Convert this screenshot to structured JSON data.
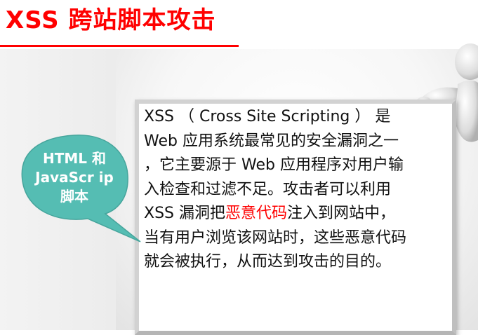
{
  "title": {
    "text": "XSS 跨站脚本攻击",
    "color": "#ff0000"
  },
  "callout": {
    "text": "HTML 和 JavaScr ip 脚本",
    "fill": "#55bdb3"
  },
  "board": {
    "line1": "XSS （ Cross Site Scripting ） 是",
    "line2": "Web 应用系统最常见的安全漏洞之一",
    "line3": "，它主要源于 Web 应用程序对用户输",
    "line4": "入检查和过滤不足。攻击者可以利用",
    "line5_before": "XSS 漏洞把",
    "line5_highlight": "恶意代码",
    "line5_after": "注入到网站中，",
    "line6": "当有用户浏览该网站时，这些恶意代码",
    "line7": "就会被执行，从而达到攻击的目的。",
    "highlight_color": "#ff0000"
  },
  "decor": {
    "figure": "3d-figure-holding-board"
  }
}
